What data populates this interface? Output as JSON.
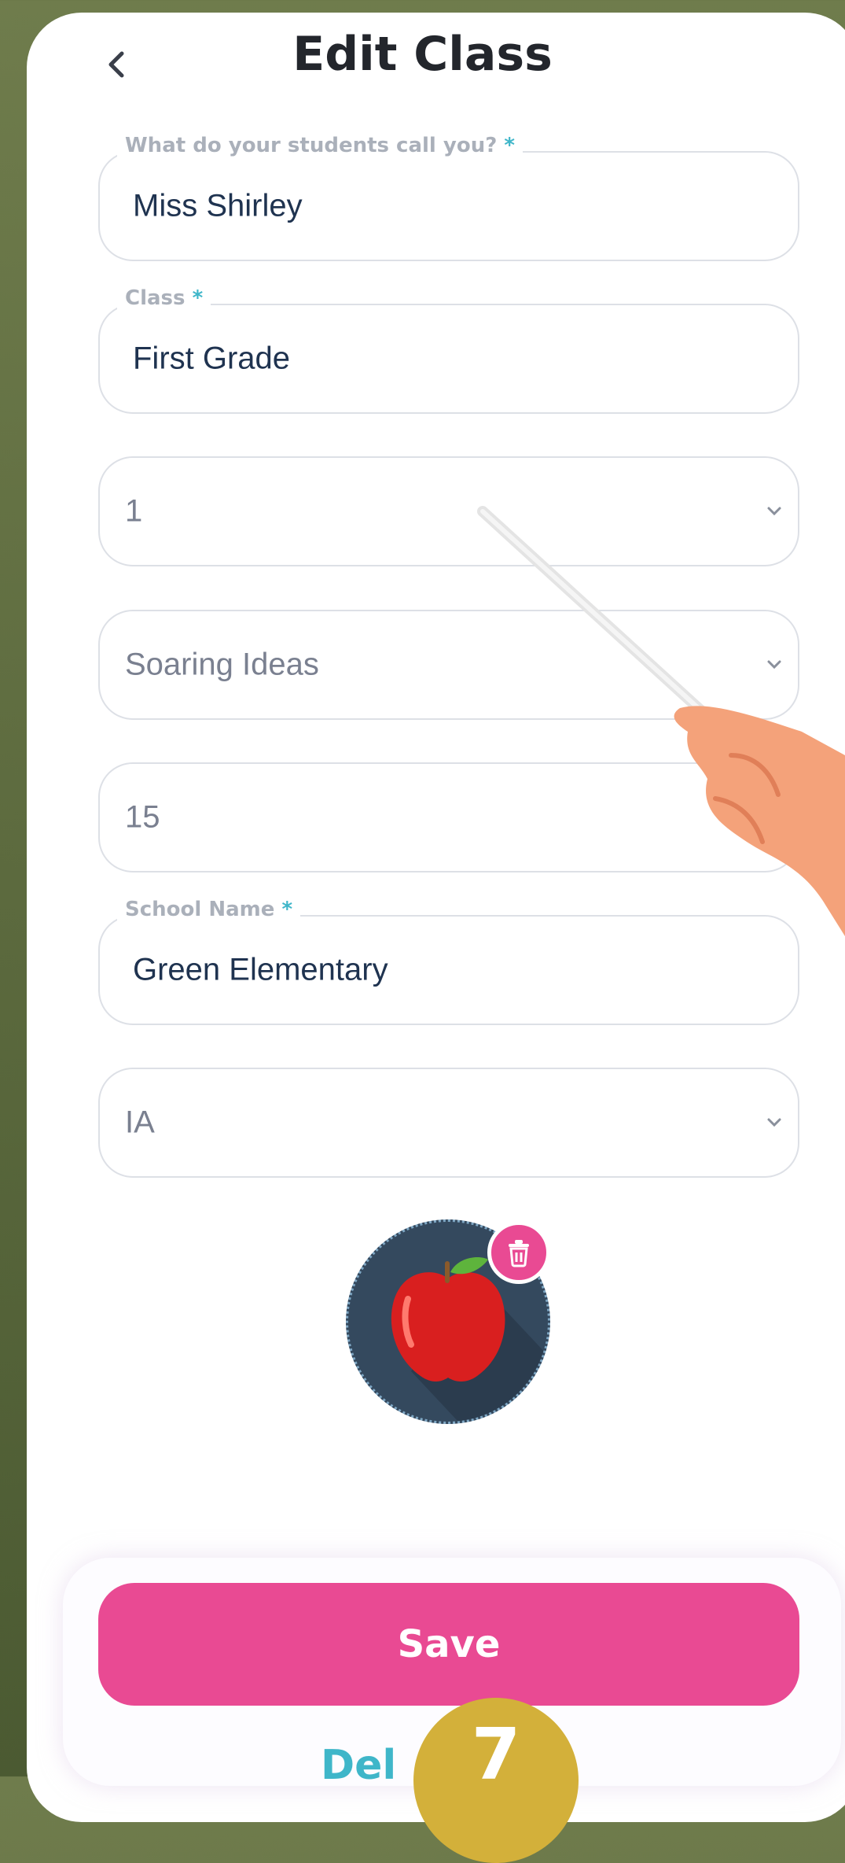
{
  "header": {
    "title": "Edit Class"
  },
  "form": {
    "teacher_name": {
      "label": "What do your students call you?",
      "required_mark": "*",
      "value": "Miss Shirley"
    },
    "class_name": {
      "label": "Class",
      "required_mark": "*",
      "value": "First Grade"
    },
    "grade_select": {
      "value": "1"
    },
    "curriculum_select": {
      "value": "Soaring Ideas"
    },
    "student_count": {
      "value": "15"
    },
    "school_name": {
      "label": "School Name",
      "required_mark": "*",
      "value": "Green Elementary"
    },
    "state_select": {
      "value": "IA"
    }
  },
  "avatar": {
    "icon": "apple-icon",
    "delete_icon": "trash-icon"
  },
  "footer": {
    "save_label": "Save",
    "delete_label_visible": "Del",
    "overlay_badge": "7"
  },
  "colors": {
    "accent": "#e94a93",
    "required": "#3fb6c9",
    "avatar_bg": "#34495e"
  }
}
